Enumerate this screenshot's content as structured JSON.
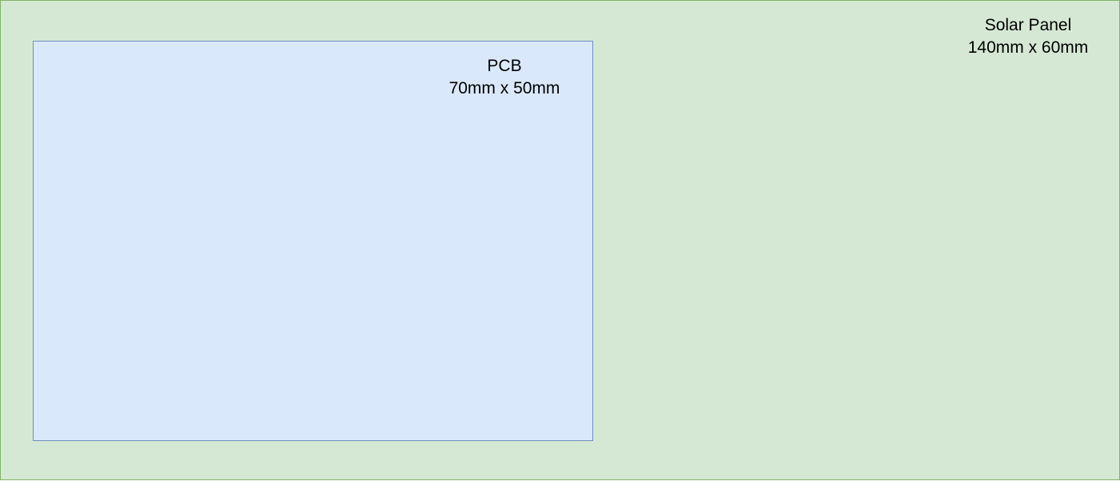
{
  "solar_panel": {
    "name": "Solar Panel",
    "dimensions": "140mm x 60mm",
    "fill_color": "#d5e8d4",
    "stroke_color": "#82b366"
  },
  "pcb": {
    "name": "PCB",
    "dimensions": "70mm x 50mm",
    "fill_color": "#dae8fc",
    "stroke_color": "#6c8ebf"
  }
}
